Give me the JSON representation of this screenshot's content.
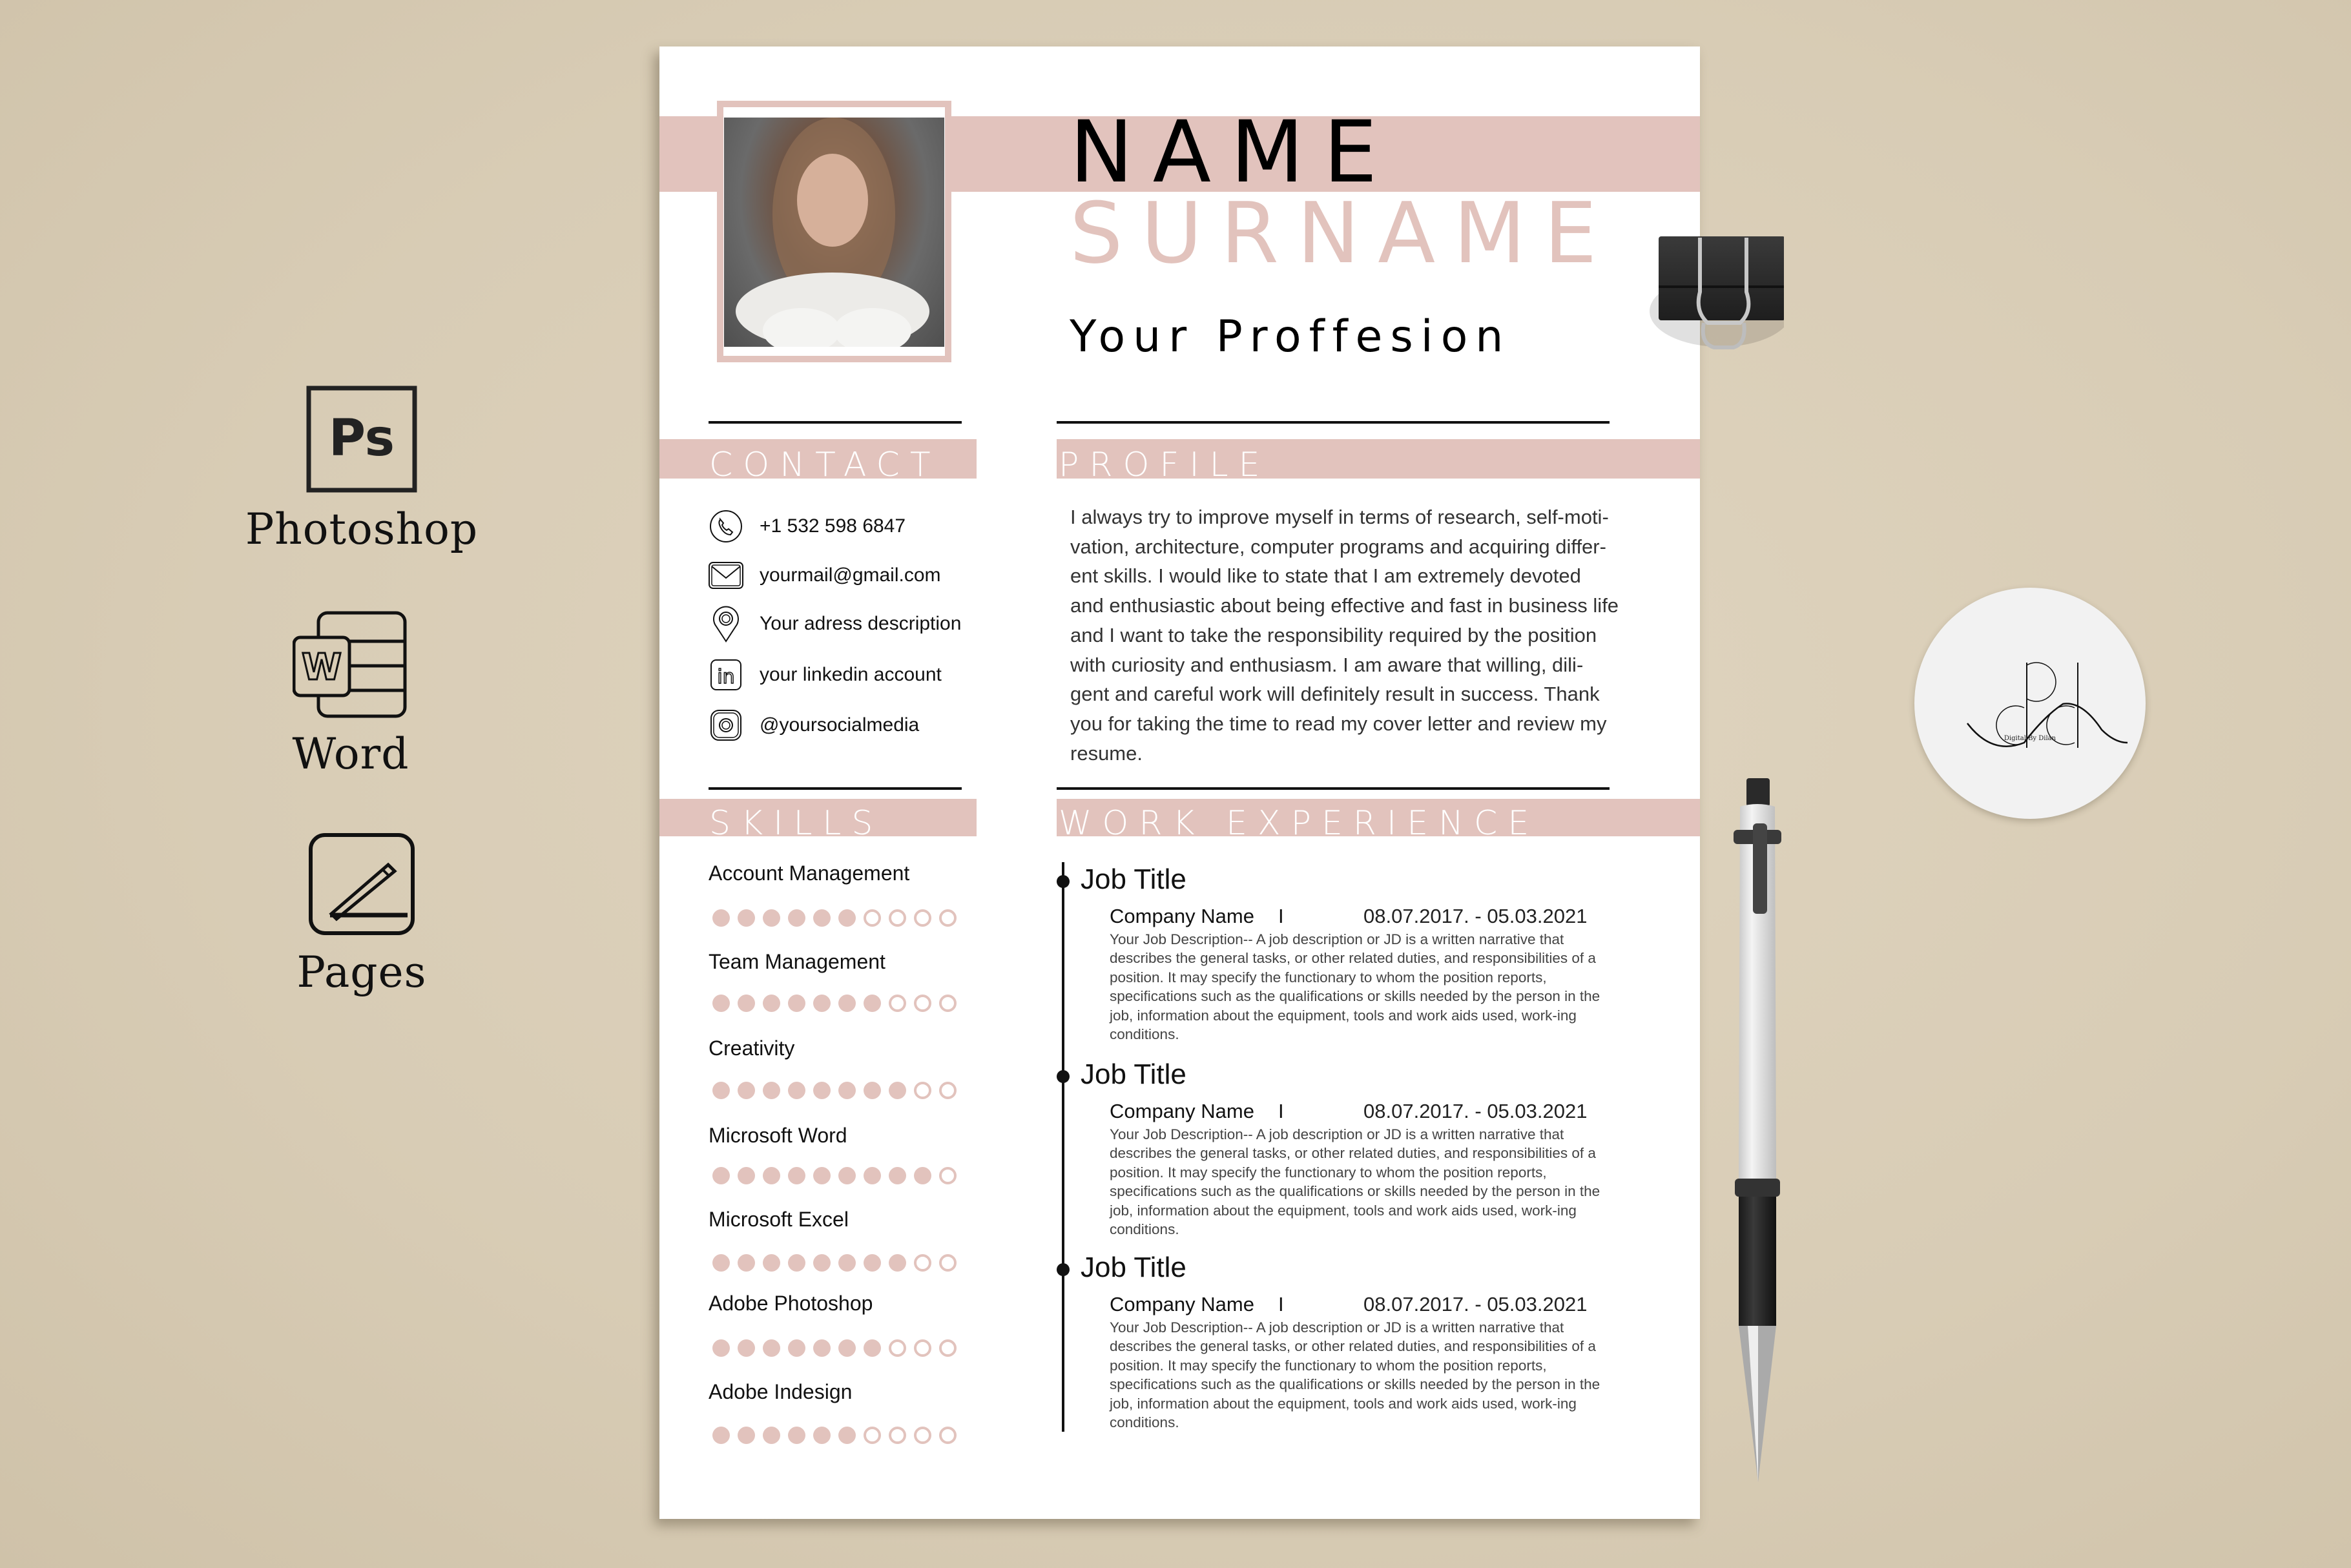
{
  "apps": [
    {
      "label": "Photoshop",
      "icon": "photoshop-icon",
      "glyph": "Ps"
    },
    {
      "label": "Word",
      "icon": "word-icon",
      "glyph": "W"
    },
    {
      "label": "Pages",
      "icon": "pages-icon",
      "glyph": ""
    }
  ],
  "resume": {
    "name": "NAME",
    "surname": "SURNAME",
    "profession": "Your Proffesion",
    "accent_color": "#e2c3bd",
    "contact": {
      "heading": "CONTACT",
      "items": [
        {
          "icon": "phone-icon",
          "text": "+1 532 598 6847"
        },
        {
          "icon": "mail-icon",
          "text": "yourmail@gmail.com"
        },
        {
          "icon": "location-pin-icon",
          "text": "Your adress description"
        },
        {
          "icon": "linkedin-icon",
          "text": "your linkedin account"
        },
        {
          "icon": "instagram-icon",
          "text": "@yoursocialmedia"
        }
      ]
    },
    "profile": {
      "heading": "PROFILE",
      "text": "I always try to improve myself in terms of research, self-moti-\nvation, architecture, computer programs and acquiring differ-\nent skills. I would like to state that I am extremely devoted\nand enthusiastic about being effective and fast in business life\nand  I want to take the responsibility required by the position\nwith curiosity and enthusiasm. I am aware that willing, dili-\ngent and careful work will definitely result in success.  Thank\nyou for taking the time to read my cover letter and review my\nresume."
    },
    "skills": {
      "heading": "SKILLS",
      "max": 10,
      "items": [
        {
          "name": "Account Management",
          "level": 6
        },
        {
          "name": "Team Management",
          "level": 7
        },
        {
          "name": "Creativity",
          "level": 8
        },
        {
          "name": "Microsoft Word",
          "level": 9
        },
        {
          "name": "Microsoft Excel",
          "level": 8
        },
        {
          "name": "Adobe Photoshop",
          "level": 7
        },
        {
          "name": "Adobe Indesign",
          "level": 6
        }
      ]
    },
    "experience": {
      "heading": "WORK EXPERIENCE",
      "jobs": [
        {
          "title": "Job Title",
          "company": "Company Name",
          "separator": "I",
          "dates": "08.07.2017. - 05.03.2021",
          "description": "Your Job Description-- A job description or JD is a written narrative that describes the general tasks, or other related duties, and responsibilities of a position. It may specify the functionary to whom the position reports, specifications such as the qualifications or skills needed by the person in the job, information about the equipment, tools and work aids used, work-ing conditions."
        },
        {
          "title": "Job Title",
          "company": "Company Name",
          "separator": "I",
          "dates": "08.07.2017. - 05.03.2021",
          "description": "Your Job Description-- A job description or JD is a written narrative that describes the general tasks, or other related duties, and responsibilities of a position. It may specify the functionary to whom the position reports, specifications such as the qualifications or skills needed by the person in the job, information about the equipment, tools and work aids used, work-ing conditions."
        },
        {
          "title": "Job Title",
          "company": "Company Name",
          "separator": "I",
          "dates": "08.07.2017. - 05.03.2021",
          "description": "Your Job Description-- A job description or JD is a written narrative that describes the general tasks, or other related duties, and responsibilities of a position. It may specify the functionary to whom the position reports, specifications such as the qualifications or skills needed by the person in the job, information about the equipment, tools and work aids used, work-ing conditions."
        }
      ]
    }
  },
  "brand_logo": {
    "monogram": "dbd",
    "caption": "Digital By Dilan"
  }
}
